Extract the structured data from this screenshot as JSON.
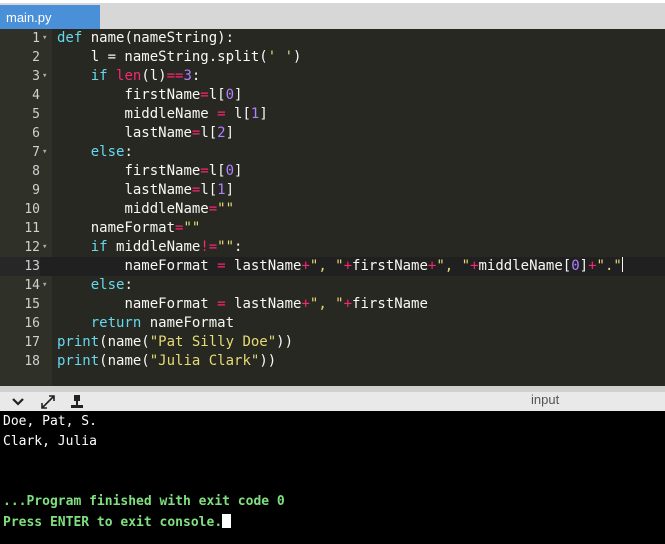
{
  "tab": {
    "filename": "main.py"
  },
  "editor": {
    "lines": [
      {
        "num": "1",
        "fold": true
      },
      {
        "num": "2",
        "fold": false
      },
      {
        "num": "3",
        "fold": true
      },
      {
        "num": "4",
        "fold": false
      },
      {
        "num": "5",
        "fold": false
      },
      {
        "num": "6",
        "fold": false
      },
      {
        "num": "7",
        "fold": true
      },
      {
        "num": "8",
        "fold": false
      },
      {
        "num": "9",
        "fold": false
      },
      {
        "num": "10",
        "fold": false
      },
      {
        "num": "11",
        "fold": false
      },
      {
        "num": "12",
        "fold": true
      },
      {
        "num": "13",
        "fold": false
      },
      {
        "num": "14",
        "fold": true
      },
      {
        "num": "15",
        "fold": false
      },
      {
        "num": "16",
        "fold": false
      },
      {
        "num": "17",
        "fold": false
      },
      {
        "num": "18",
        "fold": false
      }
    ],
    "active_line": "13",
    "code": {
      "l1": "def name(nameString):",
      "l2": "    l = nameString.split(' ')",
      "l3": "    if len(l)==3:",
      "l4": "        firstName=l[0]",
      "l5": "        middleName = l[1]",
      "l6": "        lastName=l[2]",
      "l7": "    else:",
      "l8": "        firstName=l[0]",
      "l9": "        lastName=l[1]",
      "l10": "        middleName=\"\"",
      "l11": "    nameFormat=\"\"",
      "l12": "    if middleName!=\"\":",
      "l13": "        nameFormat = lastName+\", \"+firstName+\", \"+middleName[0]+\".\"",
      "l14": "    else:",
      "l15": "        nameFormat = lastName+\", \"+firstName",
      "l16": "    return nameFormat",
      "l17": "print(name(\"Pat Silly Doe\"))",
      "l18": "print(name(\"Julia Clark\"))"
    },
    "tokens": {
      "def": "def",
      "fn": " name(nameString):",
      "l2a": "    l = nameString.split(",
      "l2b": "' '",
      "l2c": ")",
      "if": "if",
      "len": "len",
      "l3b": "(l)",
      "eqeq": "==",
      "three": "3",
      "colon": ":",
      "firstName_eq": "firstName",
      "eq": "=",
      "l_open": "l[",
      "zero": "0",
      "one": "1",
      "two": "2",
      "close": "]",
      "middleName_sp": "middleName ",
      "space_eq": "= ",
      "lastName": "lastName",
      "else": "else",
      "middleName": "middleName",
      "emptystr": "\"\"",
      "nameFormat": "nameFormat",
      "neq": "!=",
      "nameFormat_sp": "nameFormat ",
      "lastName_t": " lastName",
      "plus": "+",
      "comma_str": "\", \"",
      "firstName": "firstName",
      "middleName_idx": "middleName[",
      "dot_str": "\".\"",
      "return": "return",
      "ret_val": " nameFormat",
      "print": "print",
      "name_open": "(name(",
      "str_pat": "\"Pat Silly Doe\"",
      "str_julia": "\"Julia Clark\"",
      "close2": "))"
    }
  },
  "console_toolbar": {
    "icons": [
      "chevron-down-icon",
      "expand-icon",
      "stamp-icon"
    ],
    "input_label": "input"
  },
  "console": {
    "output": [
      "Doe, Pat, S.",
      "Clark, Julia"
    ],
    "finished": "...Program finished with exit code 0",
    "prompt": "Press ENTER to exit console."
  },
  "colors": {
    "tab": "#4a90d9",
    "editor_bg": "#272822",
    "keyword": "#66d9ef",
    "builtin": "#f92672",
    "string": "#e6db74",
    "number": "#ae81ff",
    "console_bg": "#000000",
    "console_status": "#7fe07f"
  }
}
